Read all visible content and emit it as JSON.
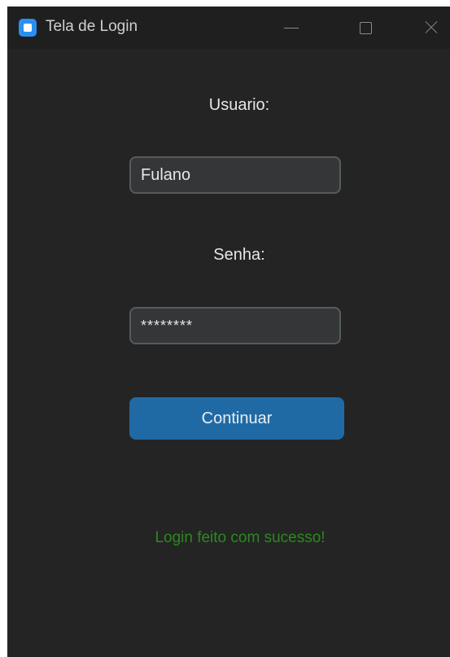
{
  "window": {
    "title": "Tela de Login",
    "controls": [
      "minimize-icon",
      "maximize-icon",
      "close-icon"
    ]
  },
  "form": {
    "username_label": "Usuario:",
    "username_value": "Fulano",
    "password_label": "Senha:",
    "password_value": "********",
    "submit_label": "Continuar"
  },
  "status": {
    "message": "Login feito com sucesso!",
    "color": "#2a8a1e"
  },
  "colors": {
    "background": "#242424",
    "titlebar": "#1f1f1f",
    "button": "#1f6aa5",
    "input_bg": "#343638",
    "input_border": "#565b5e",
    "app_icon": "#2b8ff0"
  }
}
